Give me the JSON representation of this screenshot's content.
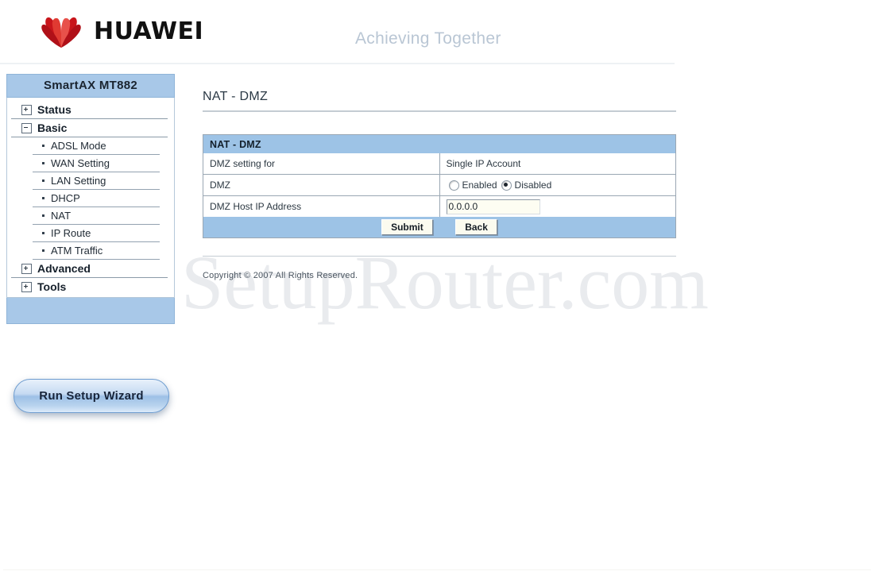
{
  "header": {
    "brand": "HUAWEI",
    "slogan": "Achieving Together",
    "logo_icon": "huawei-flower-logo",
    "logo_color": "#d7191c"
  },
  "watermark": {
    "text": "SetupRouter.com"
  },
  "sidebar": {
    "title": "SmartAX MT882",
    "items": [
      {
        "label": "Status",
        "level": "top",
        "expander": "plus",
        "icon": "plus-box-icon"
      },
      {
        "label": "Basic",
        "level": "top",
        "expander": "minus",
        "icon": "minus-box-icon"
      },
      {
        "label": "ADSL Mode",
        "level": "sub",
        "icon": "bullet-icon"
      },
      {
        "label": "WAN Setting",
        "level": "sub",
        "icon": "bullet-icon"
      },
      {
        "label": "LAN Setting",
        "level": "sub",
        "icon": "bullet-icon"
      },
      {
        "label": "DHCP",
        "level": "sub",
        "icon": "bullet-icon"
      },
      {
        "label": "NAT",
        "level": "sub",
        "icon": "bullet-icon"
      },
      {
        "label": "IP Route",
        "level": "sub",
        "icon": "bullet-icon"
      },
      {
        "label": "ATM Traffic",
        "level": "sub",
        "icon": "bullet-icon"
      },
      {
        "label": "Advanced",
        "level": "top",
        "expander": "plus",
        "icon": "plus-box-icon"
      },
      {
        "label": "Tools",
        "level": "top",
        "expander": "plus",
        "icon": "plus-box-icon"
      }
    ],
    "wizard_button": "Run Setup Wizard"
  },
  "main": {
    "page_title": "NAT - DMZ",
    "panel_title": "NAT - DMZ",
    "rows": [
      {
        "label": "DMZ setting for",
        "value": "Single IP Account",
        "type": "text"
      },
      {
        "label": "DMZ",
        "type": "radio",
        "options": [
          {
            "label": "Enabled",
            "checked": false
          },
          {
            "label": "Disabled",
            "checked": true
          }
        ]
      },
      {
        "label": "DMZ Host IP Address",
        "type": "input",
        "value": "0.0.0.0",
        "placeholder": ""
      }
    ],
    "submit_label": "Submit",
    "back_label": "Back",
    "copyright": "Copyright © 2007 All Rights Reserved."
  },
  "colors": {
    "header_blue": "#a8c8e8",
    "panel_head_blue": "#9dc3e6",
    "brand_red": "#d7191c",
    "slogan_gray": "#b9c6d4"
  }
}
